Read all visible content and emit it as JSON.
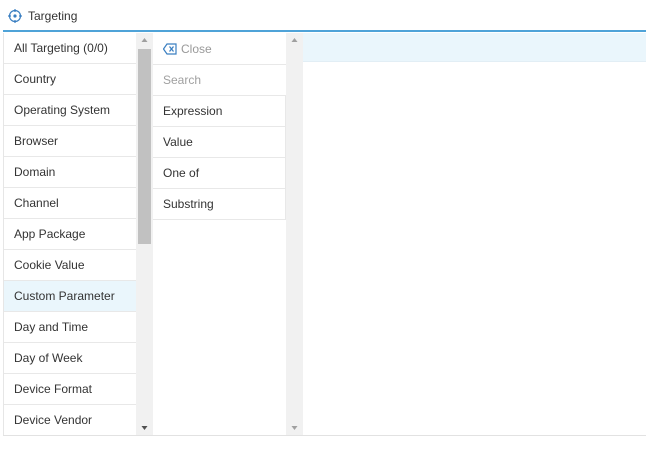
{
  "header": {
    "title": "Targeting",
    "icon": "crosshair-icon"
  },
  "categories": [
    {
      "label": "All Targeting (0/0)"
    },
    {
      "label": "Country"
    },
    {
      "label": "Operating System"
    },
    {
      "label": "Browser"
    },
    {
      "label": "Domain"
    },
    {
      "label": "Channel"
    },
    {
      "label": "App Package"
    },
    {
      "label": "Cookie Value"
    },
    {
      "label": "Custom Parameter",
      "active": true
    },
    {
      "label": "Day and Time"
    },
    {
      "label": "Day of Week"
    },
    {
      "label": "Device Format"
    },
    {
      "label": "Device Vendor"
    }
  ],
  "submenu": {
    "close_label": "Close",
    "search_placeholder": "Search",
    "options": [
      {
        "label": "Expression"
      },
      {
        "label": "Value"
      },
      {
        "label": "One of"
      },
      {
        "label": "Substring"
      }
    ]
  },
  "colors": {
    "accent": "#4fa3d8",
    "active_bg": "#eaf6fc",
    "icon": "#3a7fc1"
  }
}
